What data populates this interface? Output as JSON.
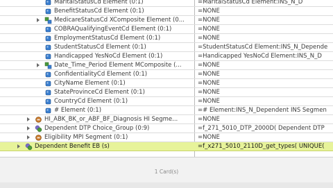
{
  "rows": [
    {
      "name": "MaritalStatusCd Element (0:1)",
      "value": "=MaritalStatusCd Element:INS_N_D",
      "icon": "element",
      "expander": false,
      "indent": 64
    },
    {
      "name": "BenefitStatusCd Element (0:1)",
      "value": "=NONE",
      "icon": "element",
      "expander": false,
      "indent": 64
    },
    {
      "name": "MedicareStatusCd XComposite Element (0...",
      "value": "=NONE",
      "icon": "composite",
      "expander": true,
      "indent": 64
    },
    {
      "name": "COBRAQualifyingEventCd Element (0:1)",
      "value": "=NONE",
      "icon": "element",
      "expander": false,
      "indent": 64
    },
    {
      "name": "EmploymentStatusCd Element (0:1)",
      "value": "=NONE",
      "icon": "element",
      "expander": false,
      "indent": 64
    },
    {
      "name": "StudentStatusCd Element (0:1)",
      "value": "=StudentStatusCd Element:INS_N_Depende",
      "icon": "element",
      "expander": false,
      "indent": 64
    },
    {
      "name": "Handicapped YesNoCd Element (0:1)",
      "value": "=Handicapped YesNoCd Element:INS_N_D",
      "icon": "element",
      "expander": false,
      "indent": 64
    },
    {
      "name": "Date_Time_Period Element MComposite (...",
      "value": "=NONE",
      "icon": "composite",
      "expander": true,
      "indent": 64
    },
    {
      "name": "ConfidentialityCd Element (0:1)",
      "value": "=NONE",
      "icon": "element",
      "expander": false,
      "indent": 64
    },
    {
      "name": "CityName Element (0:1)",
      "value": "=NONE",
      "icon": "element",
      "expander": false,
      "indent": 64
    },
    {
      "name": "StateProvinceCd Element (0:1)",
      "value": "=NONE",
      "icon": "element",
      "expander": false,
      "indent": 64
    },
    {
      "name": "CountryCd Element (0:1)",
      "value": "=NONE",
      "icon": "element",
      "expander": false,
      "indent": 64
    },
    {
      "name": "# Element (0:1)",
      "value": "=# Element:INS_N_Dependent INS Segmen",
      "icon": "element",
      "expander": false,
      "indent": 64
    },
    {
      "name": "HI_ABK_BK_or_ABF_BF_Diagnosis HI Segme...",
      "value": "=NONE",
      "icon": "segment",
      "expander": true,
      "indent": 50
    },
    {
      "name": "Dependent DTP Choice_Group (0:9)",
      "value": "=f_271_5010_DTP_2000D( Dependent DTP",
      "icon": "group",
      "expander": true,
      "indent": 50
    },
    {
      "name": "Eligibility MPI Segment (0:1)",
      "value": "=NONE",
      "icon": "segment",
      "expander": true,
      "indent": 50
    },
    {
      "name": "Dependent Benefit EB (s)",
      "value": "=f_x271_5010_2110D_get_types( UNIQUE(",
      "icon": "group",
      "expander": true,
      "indent": 36,
      "selected": true
    }
  ],
  "status": {
    "card_count": "1 Card(s)"
  },
  "colors": {
    "element_icon": "#3a7fd0",
    "composite_icon": "#4a9a3c",
    "segment_icon": "#c8782a",
    "group_icon": "#7b6fc9",
    "selected_row": "#e7f39a"
  }
}
